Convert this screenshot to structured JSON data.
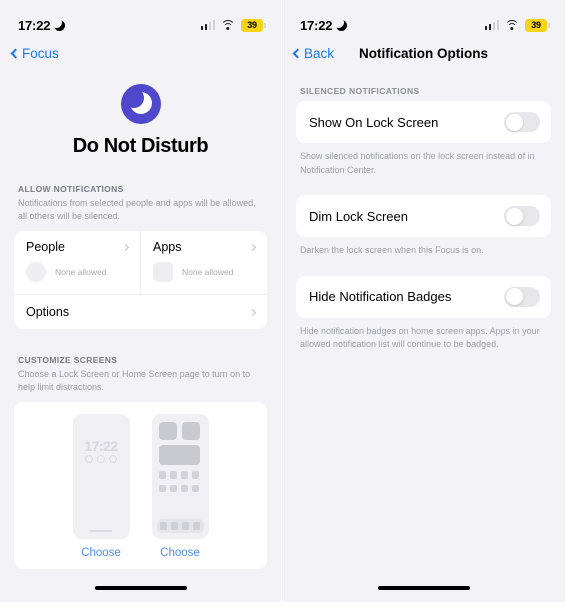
{
  "left": {
    "status": {
      "time": "17:22",
      "moon_icon": "crescent-moon-icon",
      "cellular_icon": "cellular-bars-icon",
      "wifi_icon": "wifi-icon",
      "battery": "39"
    },
    "nav": {
      "back_label": "Focus",
      "back_icon": "chevron-left-icon"
    },
    "hero": {
      "icon": "moon-icon",
      "title": "Do Not Disturb",
      "accent": "#4f47cc"
    },
    "allow": {
      "header": "ALLOW NOTIFICATIONS",
      "note": "Notifications from selected people and apps will be allowed, all others will be silenced.",
      "people": {
        "title": "People",
        "placeholder_shape": "circle",
        "value": "None allowed"
      },
      "apps": {
        "title": "Apps",
        "placeholder_shape": "rounded-square",
        "value": "None allowed"
      },
      "options_row": "Options"
    },
    "customize": {
      "header": "CUSTOMIZE SCREENS",
      "note": "Choose a Lock Screen or Home Screen page to turn on to help limit distractions.",
      "lock_preview": {
        "time": "17:22",
        "widget_dots": 3
      },
      "home_preview": {
        "widgets": 2,
        "icon_rows": 2,
        "icons_per_row": 4,
        "dock_icons": 4
      },
      "lock_choose": "Choose",
      "home_choose": "Choose",
      "link_color": "#4a8ef0"
    }
  },
  "right": {
    "status": {
      "time": "17:22",
      "moon_icon": "crescent-moon-icon",
      "battery": "39"
    },
    "nav": {
      "back_label": "Back",
      "back_icon": "chevron-left-icon",
      "title": "Notification Options"
    },
    "section_header": "SILENCED NOTIFICATIONS",
    "options": [
      {
        "label": "Show On Lock Screen",
        "state": "off",
        "note": "Show silenced notifications on the lock screen instead of in Notification Center."
      },
      {
        "label": "Dim Lock Screen",
        "state": "off",
        "note": "Darken the lock screen when this Focus is on."
      },
      {
        "label": "Hide Notification Badges",
        "state": "off",
        "note": "Hide notification badges on home screen apps. Apps in your allowed notification list will continue to be badged."
      }
    ]
  }
}
